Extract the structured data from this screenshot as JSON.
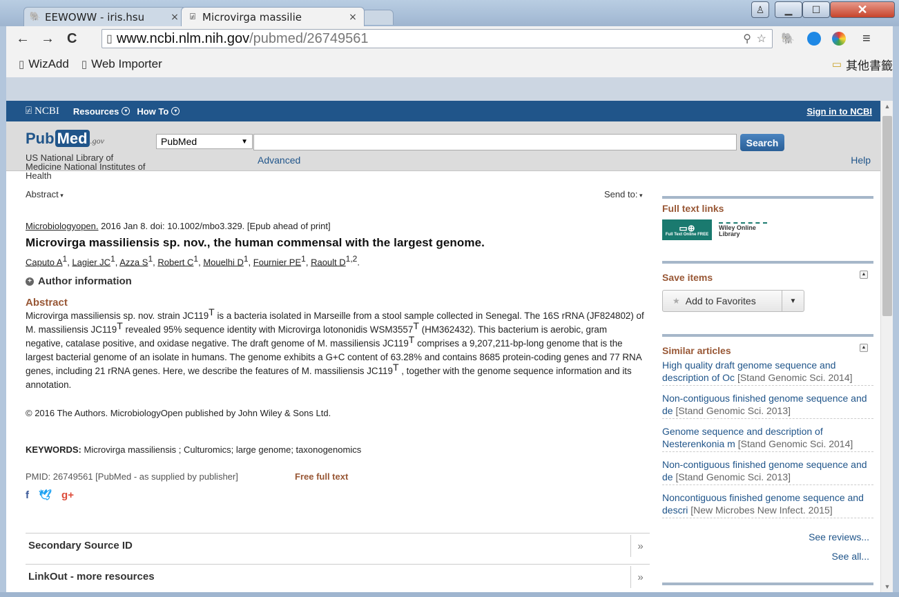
{
  "browser": {
    "tabs": [
      {
        "label": "EEWOWW - iris.hsu",
        "active": false
      },
      {
        "label": "Microvirga massilie",
        "active": true
      }
    ],
    "url_host": "www.ncbi.nlm.nih.gov",
    "url_path": "/pubmed/26749561",
    "bookmarks": [
      "WizAdd",
      "Web Importer"
    ],
    "other_bookmarks": "其他書籤"
  },
  "ncbi": {
    "logo": "NCBI",
    "menu": [
      "Resources",
      "How To"
    ],
    "signin": "Sign in to NCBI"
  },
  "search": {
    "logo_pub": "Pub",
    "logo_med": "Med",
    "logo_gov": ".gov",
    "nlm": "US National Library of Medicine National Institutes of Health",
    "database": "PubMed",
    "query": "",
    "button": "Search",
    "advanced": "Advanced",
    "help": "Help"
  },
  "article": {
    "format": "Abstract",
    "send_to": "Send to:",
    "journal": "Microbiologyopen.",
    "citation": " 2016 Jan 8. doi: 10.1002/mbo3.329. [Epub ahead of print]",
    "title": "Microvirga massiliensis sp. nov., the human commensal with the largest genome.",
    "authors": [
      {
        "name": "Caputo A",
        "aff": "1"
      },
      {
        "name": "Lagier JC",
        "aff": "1"
      },
      {
        "name": "Azza S",
        "aff": "1"
      },
      {
        "name": "Robert C",
        "aff": "1"
      },
      {
        "name": "Mouelhi D",
        "aff": "1"
      },
      {
        "name": "Fournier PE",
        "aff": "1"
      },
      {
        "name": "Raoult D",
        "aff": "1,2"
      }
    ],
    "author_info": "Author information",
    "abstract_heading": "Abstract",
    "abstract_segments": [
      "Microvirga massiliensis sp. nov. strain JC119",
      " is a bacteria isolated in Marseille from a stool sample collected in Senegal. The 16S rRNA (JF824802) of M. massiliensis JC119",
      " revealed 95% sequence identity with Microvirga lotononidis WSM3557",
      " (HM362432). This bacterium is aerobic, gram negative, catalase positive, and oxidase negative. The draft genome of M. massiliensis JC119",
      " comprises a 9,207,211-bp-long genome that is the largest bacterial genome of an isolate in humans. The genome exhibits a G+C content of 63.28% and contains 8685 protein-coding genes and 77 RNA genes, including 21 rRNA genes. Here, we describe the features of M. massiliensis JC119",
      " , together with the genome sequence information and its annotation."
    ],
    "type_strain_sup": "T",
    "copyright": "© 2016 The Authors. MicrobiologyOpen published by John Wiley & Sons Ltd.",
    "keywords_label": "KEYWORDS:",
    "keywords": " Microvirga massiliensis ; Culturomics; large genome; taxonogenomics",
    "pmid": "PMID: 26749561 [PubMed - as supplied by publisher]",
    "free_full_text": "Free full text",
    "sections": [
      "Secondary Source ID",
      "LinkOut - more resources"
    ]
  },
  "sidebar": {
    "full_text_links": "Full text links",
    "wiley_badge": "Full Text Online FREE",
    "wiley_label": "Wiley Online Library",
    "save_items": "Save items",
    "add_favorites": "Add to Favorites",
    "similar_articles": "Similar articles",
    "similar": [
      {
        "title": "High quality draft genome sequence and description of Oc",
        "src": "[Stand Genomic Sci. 2014]"
      },
      {
        "title": "Non-contiguous finished genome sequence and de",
        "src": "[Stand Genomic Sci. 2013]"
      },
      {
        "title": "Genome sequence and description of Nesterenkonia m",
        "src": "[Stand Genomic Sci. 2014]"
      },
      {
        "title": "Non-contiguous finished genome sequence and de",
        "src": "[Stand Genomic Sci. 2013]"
      },
      {
        "title": "Noncontiguous finished genome sequence and descri",
        "src": "[New Microbes New Infect. 2015]"
      }
    ],
    "see_reviews": "See reviews...",
    "see_all": "See all..."
  },
  "colors": {
    "ncbi_blue": "#20558a",
    "heading_brown": "#985735"
  }
}
